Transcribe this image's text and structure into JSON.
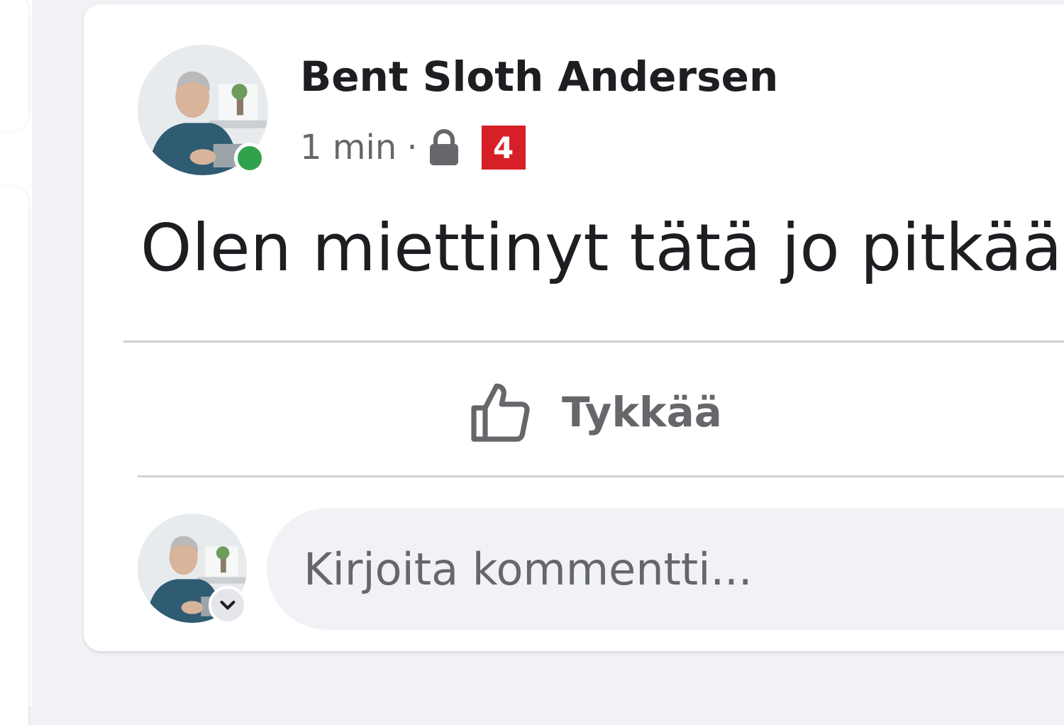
{
  "post": {
    "author": "Bent Sloth Andersen",
    "time": "1 min",
    "separator": "·",
    "badge": "4",
    "text": "Olen miettinyt tätä jo pitkään",
    "like_label": "Tykkää",
    "comment_placeholder": "Kirjoita kommentti..."
  },
  "icons": {
    "visibility": "lock-icon",
    "like": "thumbs-up-icon",
    "account_menu": "chevron-down-icon",
    "presence": "online-status-dot"
  },
  "colors": {
    "online": "#31a24c",
    "badge": "#d61f26",
    "text": "#1c1e21",
    "secondary_text": "#65676b",
    "background": "#f0f2f5"
  }
}
